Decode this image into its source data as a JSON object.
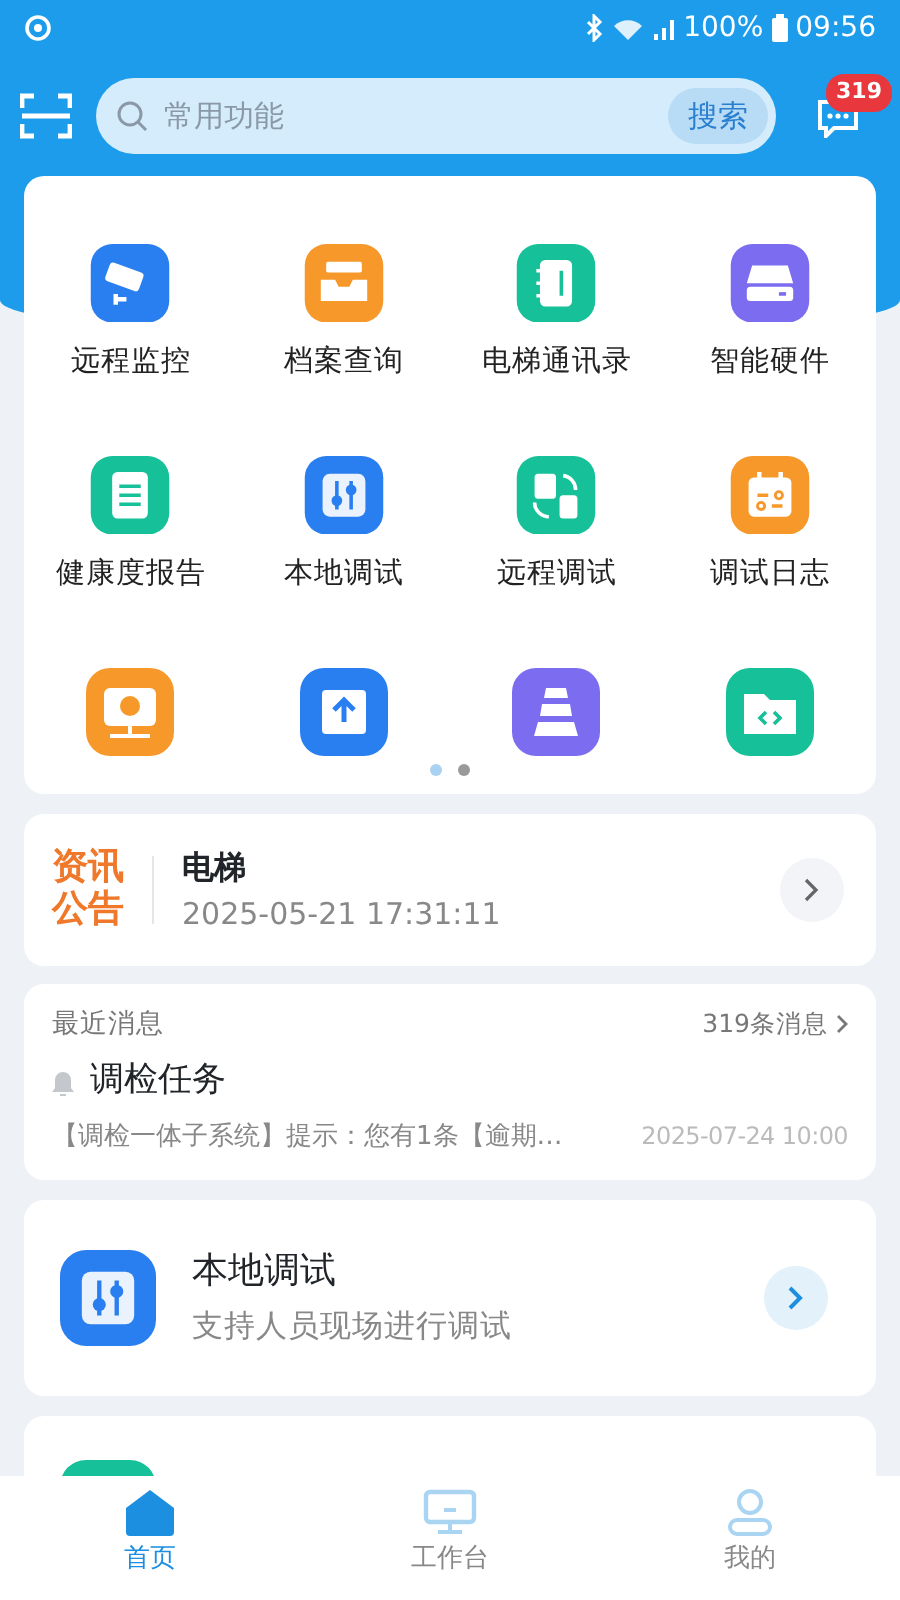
{
  "status_bar": {
    "battery": "100%",
    "time": "09:56"
  },
  "header": {
    "search": {
      "placeholder": "常用功能",
      "button": "搜索"
    },
    "message_badge": "319"
  },
  "shortcuts": [
    {
      "kind": "camera",
      "label": "远程监控",
      "color": "#2a7ff0"
    },
    {
      "kind": "tray",
      "label": "档案查询",
      "color": "#f7992a"
    },
    {
      "kind": "notebook",
      "label": "电梯通讯录",
      "color": "#16c098"
    },
    {
      "kind": "drive",
      "label": "智能硬件",
      "color": "#7b6cf0"
    },
    {
      "kind": "clipboard",
      "label": "健康度报告",
      "color": "#16c098"
    },
    {
      "kind": "sliders",
      "label": "本地调试",
      "color": "#2a7ff0"
    },
    {
      "kind": "devices",
      "label": "远程调试",
      "color": "#16c098"
    },
    {
      "kind": "calendar",
      "label": "调试日志",
      "color": "#f7992a"
    },
    {
      "kind": "monitor",
      "color": "#f7992a"
    },
    {
      "kind": "upload",
      "color": "#2a7ff0"
    },
    {
      "kind": "layers",
      "color": "#7b6cf0"
    },
    {
      "kind": "folder",
      "color": "#16c098"
    }
  ],
  "pager": [
    {
      "selected": true
    },
    {
      "selected": false
    }
  ],
  "announcement": {
    "tag_line1": "资讯",
    "tag_line2": "公告",
    "title": "电梯",
    "time": "2025-05-21 17:31:11"
  },
  "messages": {
    "heading": "最近消息",
    "count": "319条消息",
    "title": "调检任务",
    "body": "【调检一体子系统】提示：您有1条【逾期…",
    "time": "2025-07-24 10:00"
  },
  "feature_cards": [
    {
      "kind": "sliders",
      "title": "本地调试",
      "subtitle": "支持人员现场进行调试",
      "color": "#2a7ff0"
    },
    {
      "color": "#16c098"
    }
  ],
  "tabs": [
    {
      "kind": "home",
      "label": "首页",
      "selected": true
    },
    {
      "kind": "desk",
      "label": "工作台",
      "selected": false
    },
    {
      "kind": "user",
      "label": "我的",
      "selected": false
    }
  ]
}
